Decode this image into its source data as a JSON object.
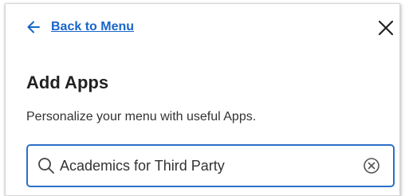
{
  "header": {
    "back_label": "Back to Menu",
    "close_icon": "close-icon",
    "back_icon": "arrow-left-icon"
  },
  "main": {
    "title": "Add Apps",
    "subtitle": "Personalize your menu with useful Apps."
  },
  "search": {
    "value": "Academics for Third Party",
    "icon": "search-icon",
    "clear_icon": "clear-circle-icon"
  },
  "colors": {
    "accent": "#1a66c9",
    "border_focus": "#2d70c8",
    "text": "#222222"
  }
}
